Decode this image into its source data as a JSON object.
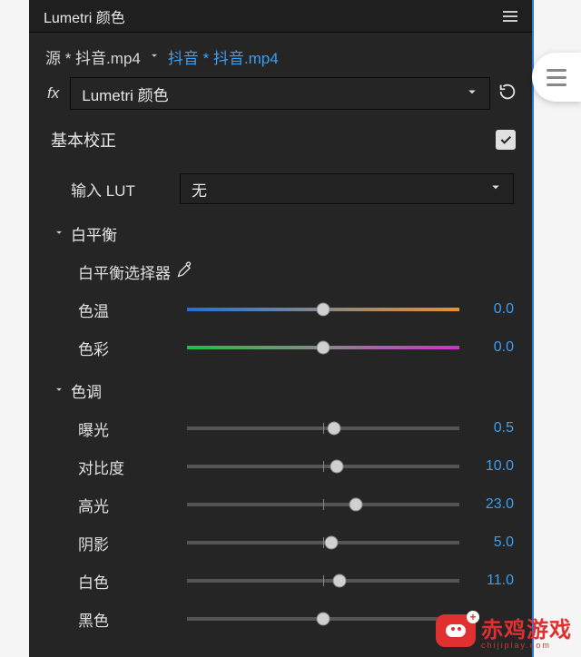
{
  "panel": {
    "title": "Lumetri 颜色",
    "source_clip": "源 * 抖音.mp4",
    "sequence_clip": "抖音 * 抖音.mp4",
    "effect_name": "Lumetri 颜色",
    "fx_label": "fx"
  },
  "basic_correction": {
    "title": "基本校正",
    "enabled": true,
    "input_lut_label": "输入 LUT",
    "input_lut_value": "无"
  },
  "white_balance": {
    "title": "白平衡",
    "picker_label": "白平衡选择器",
    "temperature": {
      "label": "色温",
      "value": "0.0",
      "pos": 50
    },
    "tint": {
      "label": "色彩",
      "value": "0.0",
      "pos": 50
    }
  },
  "tone": {
    "title": "色调",
    "exposure": {
      "label": "曝光",
      "value": "0.5",
      "pos": 54
    },
    "contrast": {
      "label": "对比度",
      "value": "10.0",
      "pos": 55
    },
    "highlights": {
      "label": "高光",
      "value": "23.0",
      "pos": 62
    },
    "shadows": {
      "label": "阴影",
      "value": "5.0",
      "pos": 53
    },
    "whites": {
      "label": "白色",
      "value": "11.0",
      "pos": 56
    },
    "blacks": {
      "label": "黑色",
      "value": "",
      "pos": 50
    }
  },
  "watermark": {
    "brand": "赤鸡游戏",
    "domain": "chijiplay.com"
  }
}
